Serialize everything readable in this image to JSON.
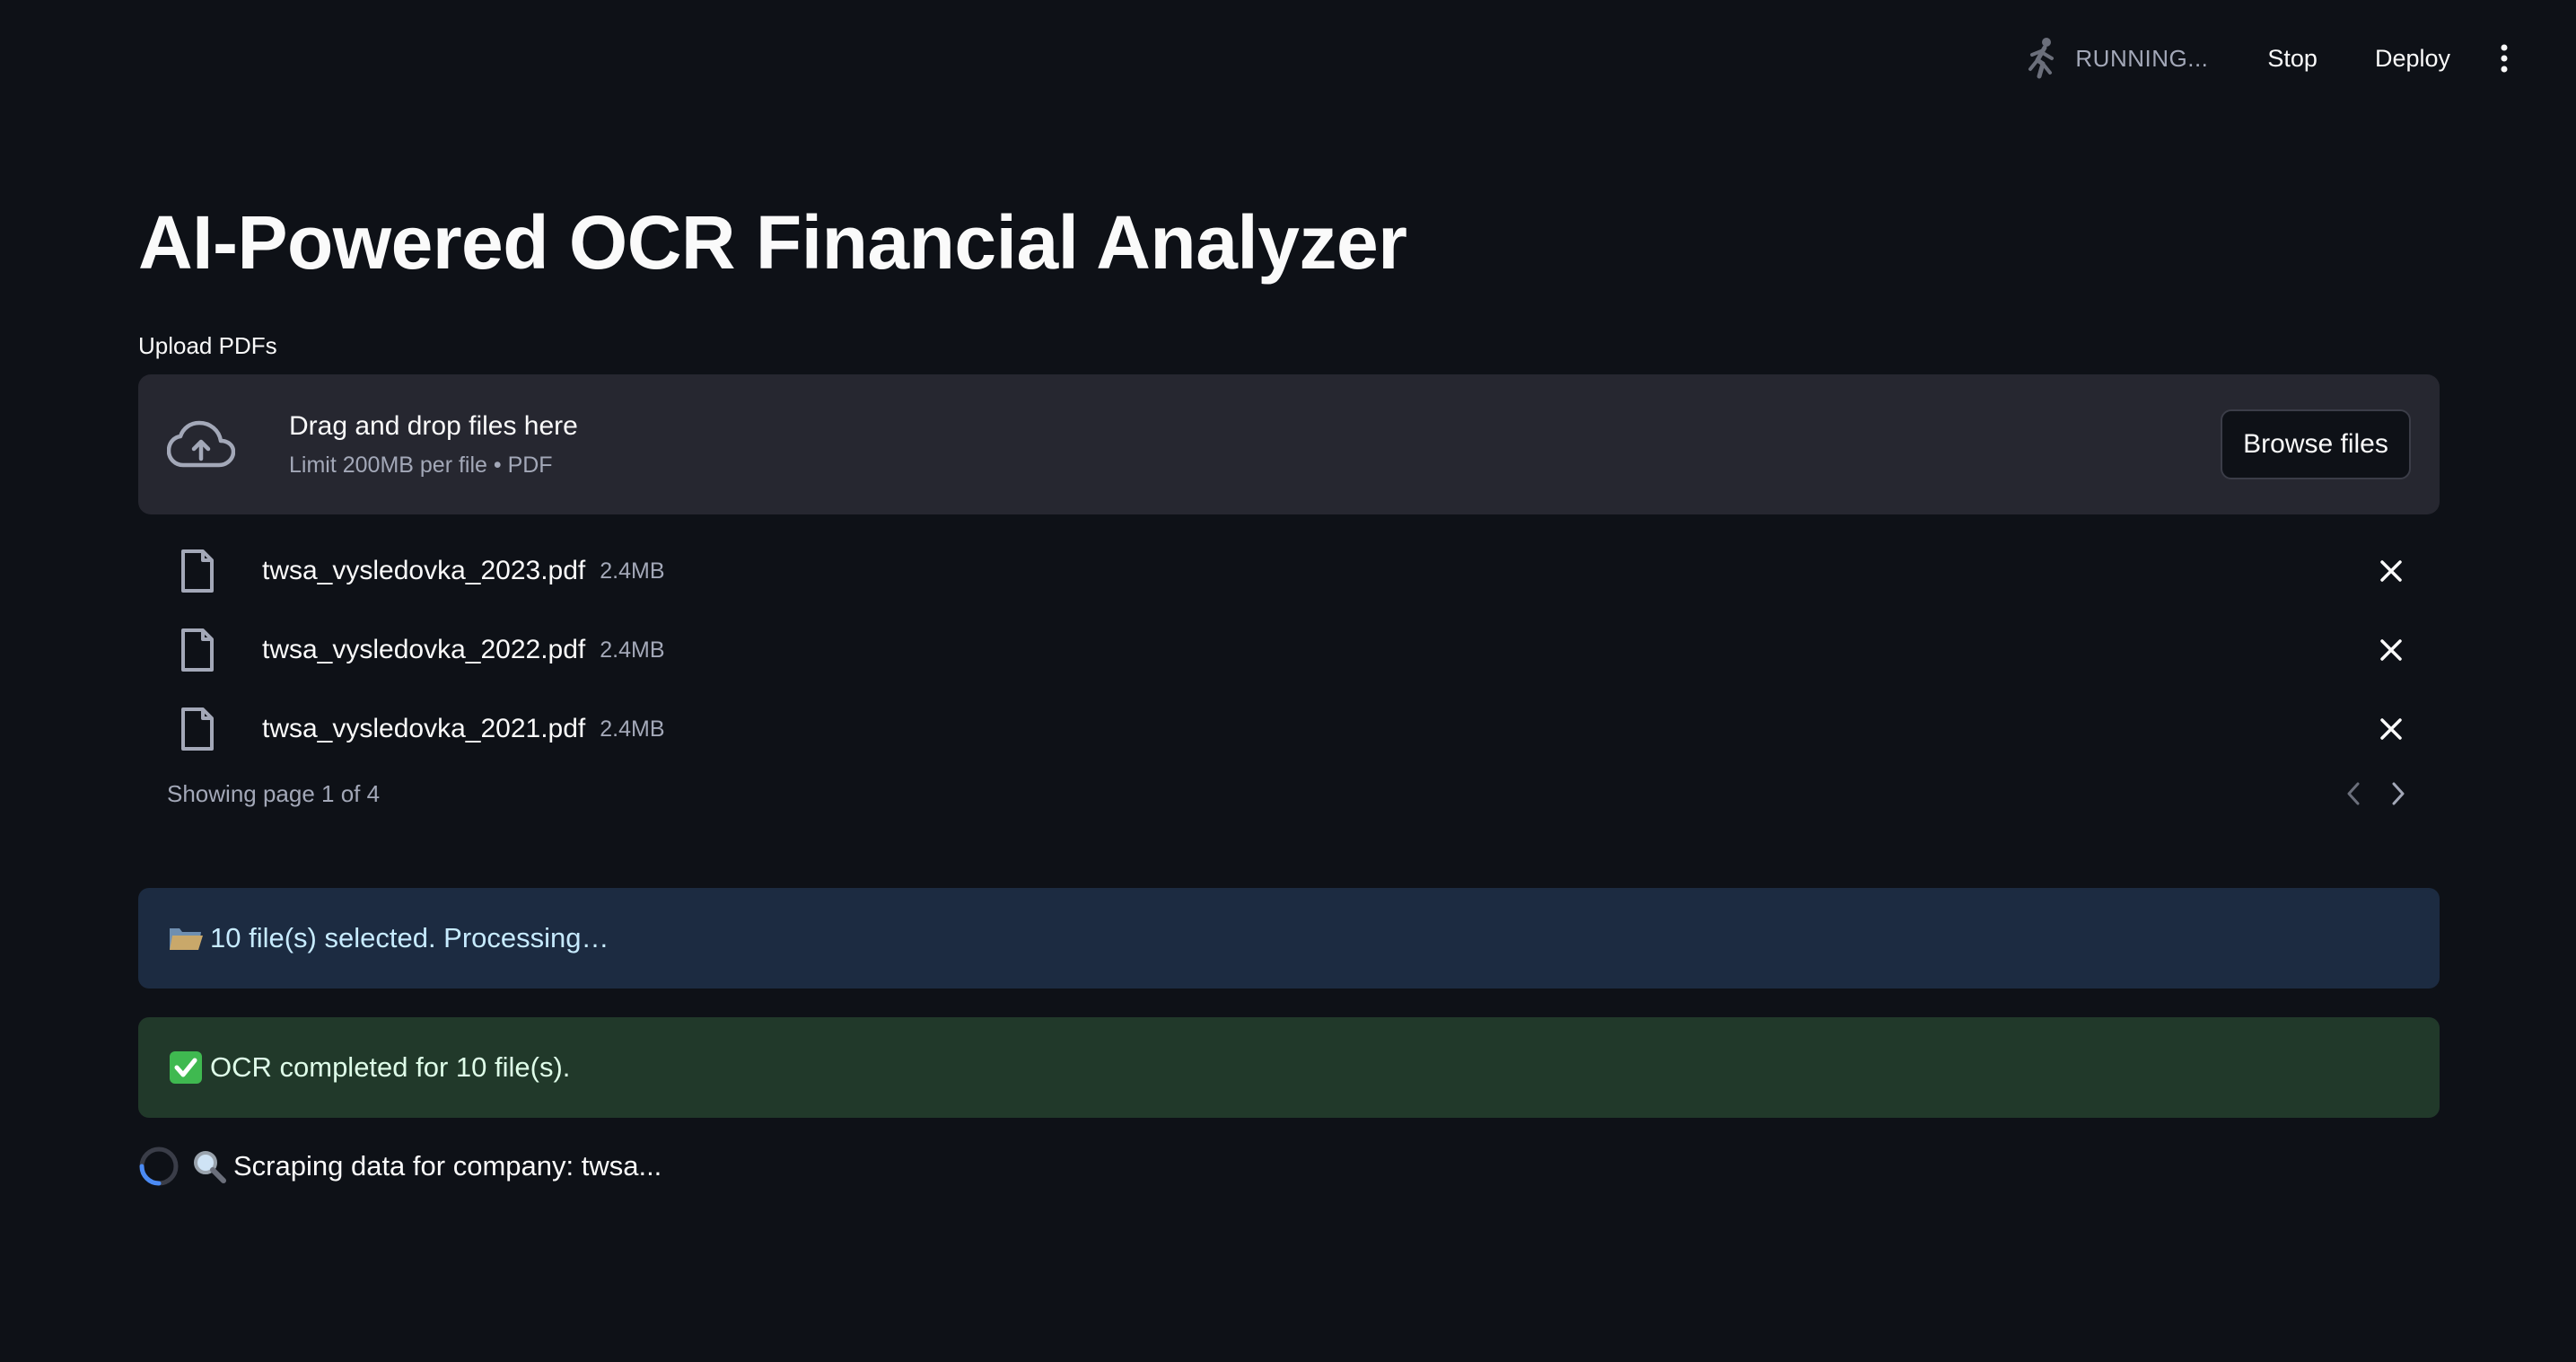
{
  "toolbar": {
    "status_text": "RUNNING...",
    "stop_label": "Stop",
    "deploy_label": "Deploy"
  },
  "page": {
    "title": "AI-Powered OCR Financial Analyzer"
  },
  "uploader": {
    "label": "Upload PDFs",
    "drop_title": "Drag and drop files here",
    "drop_subtitle": "Limit 200MB per file • PDF",
    "browse_label": "Browse files",
    "files": [
      {
        "name": "twsa_vysledovka_2023.pdf",
        "size": "2.4MB"
      },
      {
        "name": "twsa_vysledovka_2022.pdf",
        "size": "2.4MB"
      },
      {
        "name": "twsa_vysledovka_2021.pdf",
        "size": "2.4MB"
      }
    ],
    "pagination_text": "Showing page 1 of 4"
  },
  "alerts": {
    "info_text": "10 file(s) selected. Processing…",
    "success_text": "OCR completed for 10 file(s)."
  },
  "spinner": {
    "text": "Scraping data for company: twsa..."
  },
  "colors": {
    "background": "#0e1117",
    "dropzone": "#262730",
    "info_bg": "#1c2b41",
    "success_bg": "#21392a",
    "spinner_accent": "#4b8bf5"
  }
}
